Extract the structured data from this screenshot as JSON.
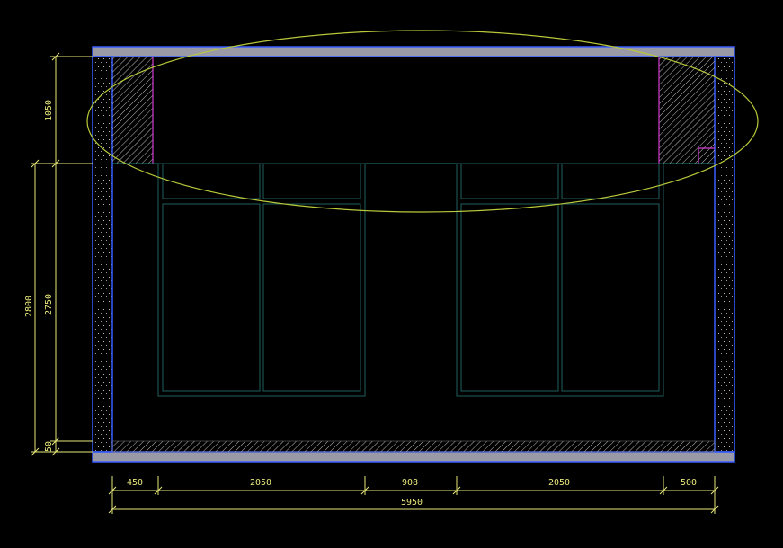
{
  "drawing": {
    "background": "#000000",
    "colors": {
      "slab": "#9a9aa6",
      "slab_edge": "#3a5cff",
      "wall_edge": "#3a5cff",
      "hatch": "#c8c8c8",
      "cabinet": "#1f5f5f",
      "magenta": "#d23cd2",
      "ellipse": "#b9c93a",
      "dimension": "#e8e87a"
    }
  },
  "dimensions": {
    "left": {
      "upper_height": "1050",
      "middle_height": "2750",
      "bottom_height": "50",
      "total_height": "2800"
    },
    "bottom": {
      "seg1": "450",
      "seg2": "2050",
      "seg3": "908",
      "seg4": "2050",
      "seg5": "500",
      "total": "5950"
    }
  }
}
